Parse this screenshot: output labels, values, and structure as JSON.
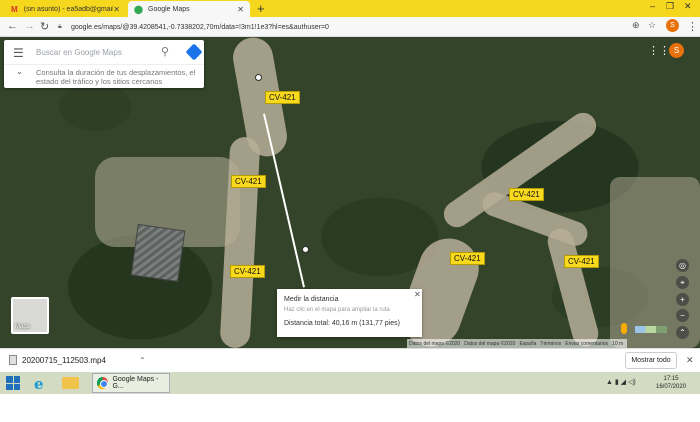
{
  "browser": {
    "tabs": [
      {
        "label": "(sin asunto) - ea5adb@gmail.com",
        "icon": "gmail-icon"
      },
      {
        "label": "Google Maps",
        "icon": "maps-pin-icon"
      }
    ],
    "url": "google.es/maps/@39.4208541,-0.7338202,70m/data=!3m1!1e3?hl=es&authuser=0",
    "avatar_initial": "S"
  },
  "map": {
    "search_placeholder": "Buscar en Google Maps",
    "search_hint": "Consulta la duración de tus desplazamientos, el estado del tráfico y los sitios cercanos",
    "route_label": "CV-421",
    "measure_title": "Medir la distancia",
    "measure_hint": "Haz clic en el mapa para ampliar la ruta",
    "measure_total": "Distancia total: 40,16 m (131,77 pies)",
    "thumb_label": "Mapa",
    "footer": [
      "Datos del mapa ©2020",
      "Datos del mapa ©2020",
      "España",
      "Términos",
      "Enviar comentarios",
      "10 m"
    ]
  },
  "downloads": {
    "file": "20200715_112503.mp4",
    "show_all": "Mostrar todo"
  },
  "taskbar": {
    "chrome_item": "Google Maps - G...",
    "time": "17:15",
    "date": "16/07/2020"
  }
}
